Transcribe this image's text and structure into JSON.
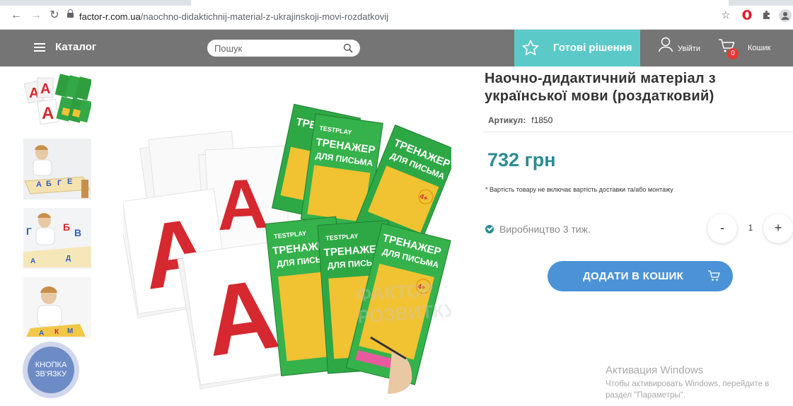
{
  "browser": {
    "url_domain": "factor-r.com.ua",
    "url_path": "/naochno-didaktichnij-material-z-ukrajinskoji-movi-rozdatkovij"
  },
  "header": {
    "catalog_label": "Каталог",
    "search_placeholder": "Пошук",
    "ready_solutions_label": "Готові рішення",
    "login_label": "Увійти",
    "cart_label": "Кошик",
    "cart_count": "0",
    "colors": {
      "header_bg": "#757575",
      "ready_bg": "#5cc9c9"
    }
  },
  "product": {
    "title": "Наочно-дидактичний матеріал з української мови (роздатковий)",
    "sku_label": "Артикул:",
    "sku_value": "f1850",
    "price": "732 грн",
    "price_note": "* Вартість товару не включає вартість доставки та/або монтажу",
    "production": "Виробництво 3 тиж.",
    "quantity": "1",
    "minus_label": "-",
    "plus_label": "+",
    "add_to_cart_label": "ДОДАТИ В КОШИК",
    "colors": {
      "price": "#2a8c93",
      "add_button": "#4b93d6"
    }
  },
  "thumbnails": [
    {
      "icon": "letters-cards-thumb"
    },
    {
      "icon": "child-table-thumb"
    },
    {
      "icon": "child-letters-thumb"
    },
    {
      "icon": "child-writing-thumb"
    }
  ],
  "contact_button": {
    "label": "КНОПКА ЗВ'ЯЗКУ"
  },
  "main_image": {
    "card_letter": "A",
    "pack_brand": "TESTPLAY",
    "pack_line1": "ТРЕНАЖЕР",
    "pack_line2": "ДЛЯ ПИСЬМА",
    "pack_age": "4+",
    "watermark_line1": "ФАКТОР",
    "watermark_line2": "РОЗВИТКУ"
  },
  "os_watermark": {
    "line1": "Активация Windows",
    "line2": "Чтобы активировать Windows, перейдите в",
    "line3": "раздел \"Параметры\"."
  }
}
